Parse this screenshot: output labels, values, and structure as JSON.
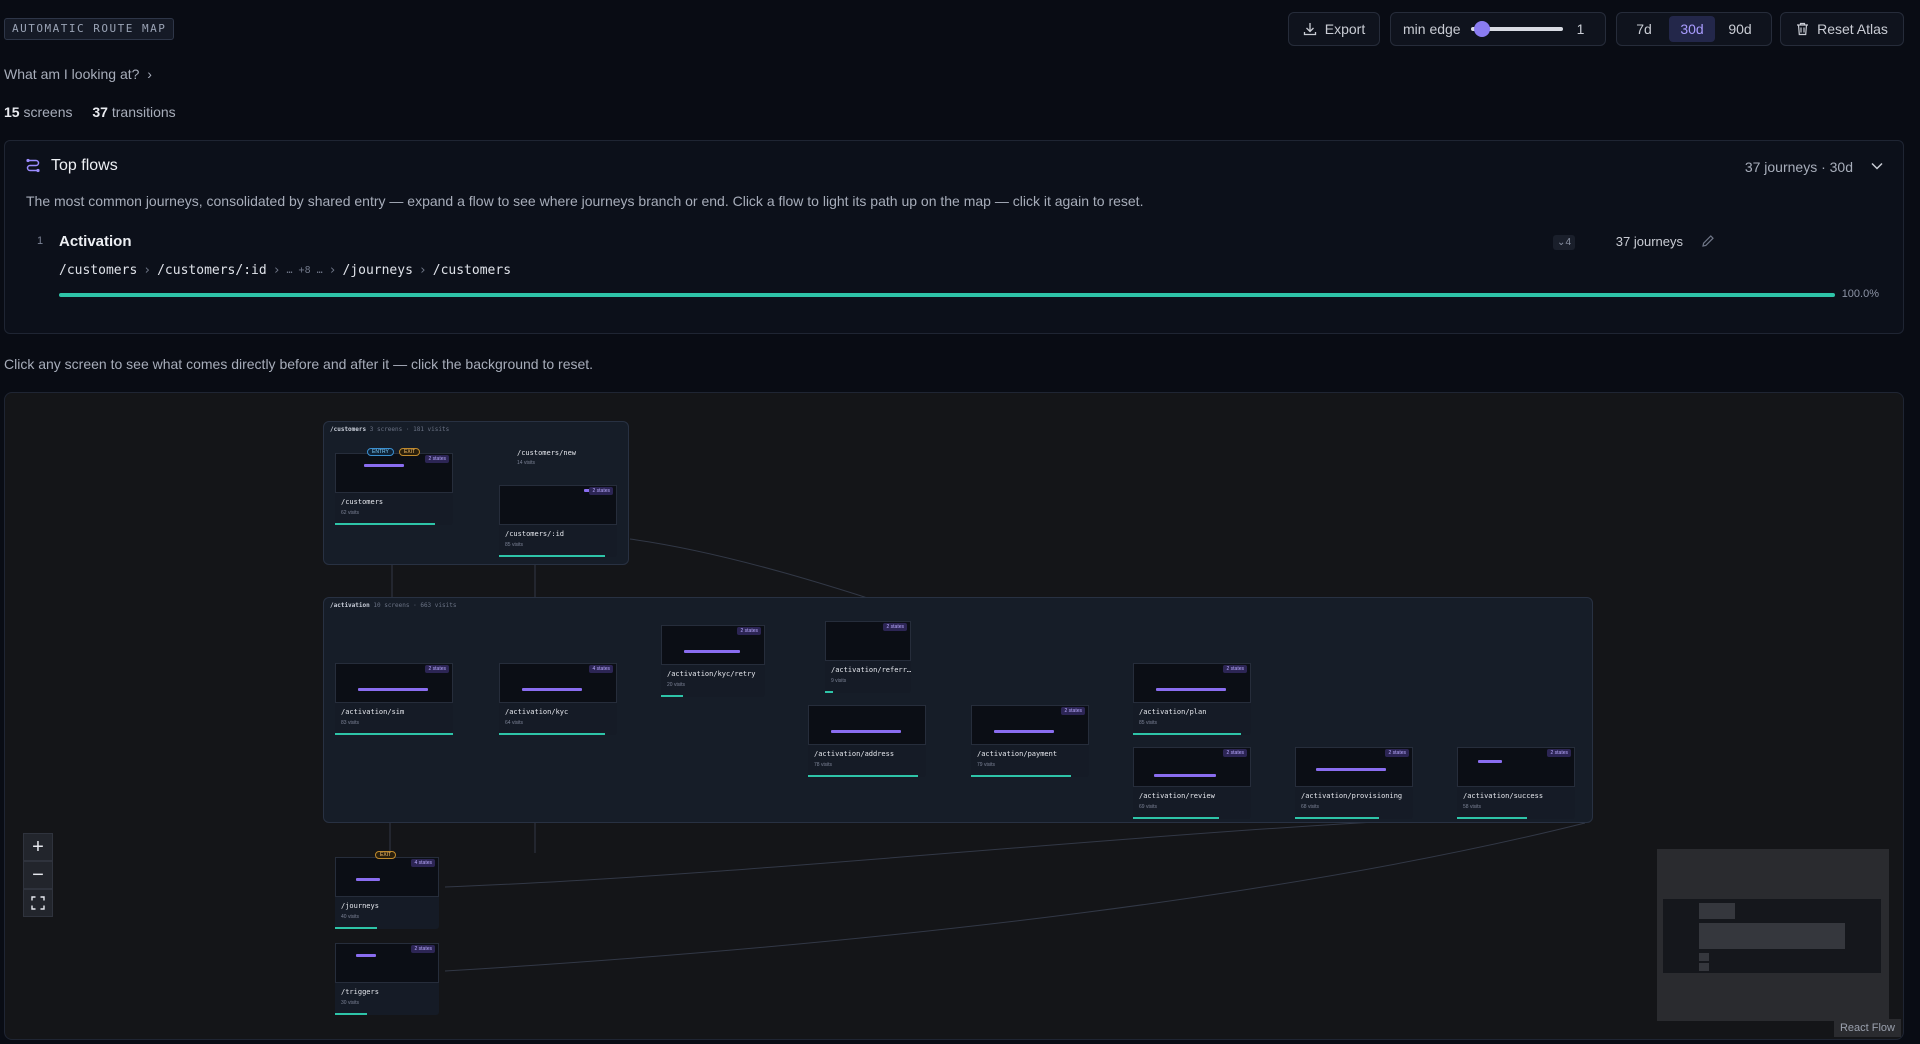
{
  "header": {
    "tag": "AUTOMATIC ROUTE MAP",
    "export_label": "Export",
    "min_edge_label": "min edge",
    "min_edge_value": "1",
    "min_edge_fraction": 0.05,
    "ranges": [
      "7d",
      "30d",
      "90d"
    ],
    "active_range": "30d",
    "reset_label": "Reset Atlas"
  },
  "explain": {
    "question": "What am I looking at?",
    "chevron": "›"
  },
  "counts": {
    "screens": "15",
    "screens_label": "screens",
    "transitions": "37",
    "transitions_label": "transitions"
  },
  "top_flows": {
    "title": "Top flows",
    "meta": "37 journeys · 30d",
    "description": "The most common journeys, consolidated by shared entry — expand a flow to see where journeys branch or end. Click a flow to light its path up on the map — click it again to reset.",
    "flows": [
      {
        "rank": "1",
        "name": "Activation",
        "variants": "4",
        "journeys": "37 journeys",
        "path": [
          "/customers",
          "/customers/:id",
          "… +8 …",
          "/journeys",
          "/customers"
        ],
        "percent_label": "100.0%",
        "percent": 100
      }
    ]
  },
  "map_hint": "Click any screen to see what comes directly before and after it — click the background to reset.",
  "map": {
    "groups": [
      {
        "name": "/customers",
        "meta": "3 screens · 181 visits"
      },
      {
        "name": "/activation",
        "meta": "10 screens · 663 visits"
      }
    ],
    "nodes": [
      {
        "route": "/customers",
        "visits": "62 visits",
        "states": "2 states"
      },
      {
        "route": "/customers/new",
        "visits": "14 visits"
      },
      {
        "route": "/customers/:id",
        "visits": "85 visits",
        "states": "2 states"
      },
      {
        "route": "/activation/sim",
        "visits": "83 visits",
        "states": "2 states"
      },
      {
        "route": "/activation/kyc",
        "visits": "64 visits",
        "states": "4 states"
      },
      {
        "route": "/activation/kyc/retry",
        "visits": "20 visits",
        "states": "2 states"
      },
      {
        "route": "/activation/referr…",
        "visits": "9 visits",
        "states": "2 states"
      },
      {
        "route": "/activation/address",
        "visits": "78 visits"
      },
      {
        "route": "/activation/payment",
        "visits": "79 visits",
        "states": "2 states"
      },
      {
        "route": "/activation/plan",
        "visits": "85 visits",
        "states": "2 states"
      },
      {
        "route": "/activation/review",
        "visits": "69 visits",
        "states": "2 states"
      },
      {
        "route": "/activation/provisioning",
        "visits": "68 visits",
        "states": "2 states"
      },
      {
        "route": "/activation/success",
        "visits": "58 visits",
        "states": "2 states"
      },
      {
        "route": "/journeys",
        "visits": "40 visits",
        "states": "4 states"
      },
      {
        "route": "/triggers",
        "visits": "30 visits",
        "states": "2 states"
      }
    ],
    "badges": {
      "entry": "ENTRY",
      "exit": "EXIT"
    },
    "attribution": "React Flow",
    "accent": "#8a6df0",
    "flow_color": "#2ec4a8"
  }
}
